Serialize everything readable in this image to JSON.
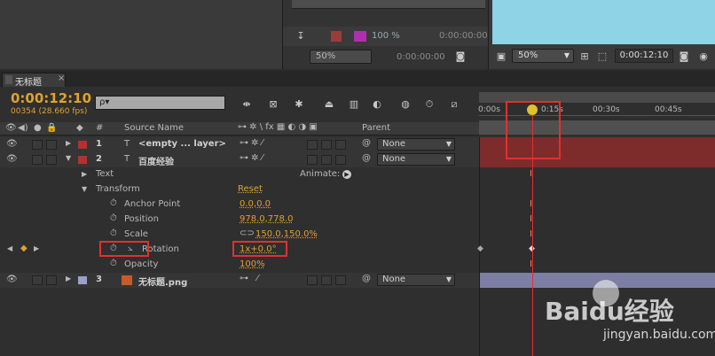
{
  "top": {
    "pct1": "100 %",
    "tc1": "0:00:00:00",
    "zoom1": "50%",
    "tc2": "0:00:00:00",
    "zoom2": "50%",
    "tc3": "0:00:12:10"
  },
  "tab": {
    "title": "无标题",
    "close": "×"
  },
  "time": {
    "current": "0:00:12:10",
    "frames": "00354 (28.660 fps)",
    "search_placeholder": "ρ▾"
  },
  "columns": {
    "hash": "#",
    "source_name": "Source Name",
    "parent": "Parent"
  },
  "ruler": {
    "t0": "0:00s",
    "t1": "0:15s",
    "t2": "00:30s",
    "t3": "00:45s"
  },
  "layers": [
    {
      "num": "1",
      "name": "<empty ... layer>",
      "parent": "None",
      "color": "#b03232",
      "twirl": "▶"
    },
    {
      "num": "2",
      "name": "百度经验",
      "parent": "None",
      "color": "#b03232",
      "twirl": "▼"
    },
    {
      "num": "3",
      "name": "无标题.png",
      "parent": "None",
      "color": "#9aa0c8",
      "twirl": "▶"
    }
  ],
  "props": {
    "text": "Text",
    "animate": "Animate:",
    "transform": "Transform",
    "reset": "Reset",
    "anchor_label": "Anchor Point",
    "anchor_value": "0.0,0.0",
    "position_label": "Position",
    "position_value": "978.0,778.0",
    "scale_label": "Scale",
    "scale_value": "150.0,150.0%",
    "rotation_label": "Rotation",
    "rotation_value": "1x+0.0°",
    "opacity_label": "Opacity",
    "opacity_value": "100%"
  },
  "colors": {
    "accent_orange": "#e0a22c",
    "playhead_red": "#e23030",
    "preview_sky": "#8ed3e6"
  },
  "watermark": {
    "brand": "Baidu经验",
    "url": "jingyan.baidu.com"
  }
}
